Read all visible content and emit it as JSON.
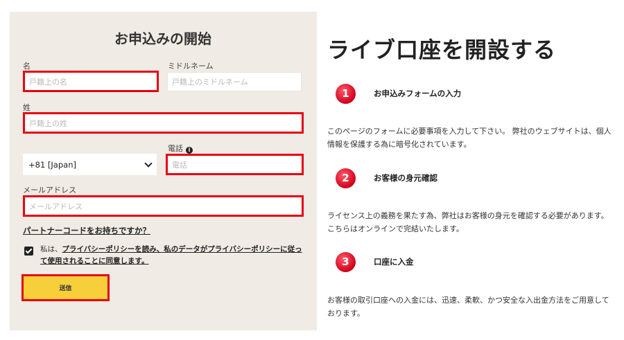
{
  "form": {
    "title": "お申込みの開始",
    "first_name": {
      "label": "名",
      "placeholder": "戸籍上の名"
    },
    "middle_name": {
      "label": "ミドルネーム",
      "placeholder": "戸籍上のミドルネーム"
    },
    "last_name": {
      "label": "姓",
      "placeholder": "戸籍上の姓"
    },
    "country_code": {
      "selected": "+81 [Japan]"
    },
    "phone": {
      "label": "電話",
      "placeholder": "電話"
    },
    "email": {
      "label": "メールアドレス",
      "placeholder": "メールアドレス"
    },
    "partner_link": "パートナーコードをお持ちですか？",
    "consent": {
      "prefix": "私は、",
      "link": "プライバシーポリシーを読み、私のデータがプライバシーポリシーに従って使用されることに同意します。"
    },
    "submit_label": "送信"
  },
  "info": {
    "title": "ライブ口座を開設する",
    "steps": [
      {
        "number": "1",
        "title": "お申込みフォームの入力",
        "desc_line1": "このページのフォームに必要事項を入力して下さい。 弊社のウェブサイトは、個人",
        "desc_line2": "情報を保護する為に暗号化されています。"
      },
      {
        "number": "2",
        "title": "お客様の身元確認",
        "desc_line1": "ライセンス上の義務を果たす為、弊社はお客様の身元を確認する必要があります。",
        "desc_line2": "こちらはオンラインで完結いたします。"
      },
      {
        "number": "3",
        "title": "口座に入金",
        "desc_line1": "お客様の取引口座への入金には、迅速、柔軟、かつ安全な入出金方法をご用意して",
        "desc_line2": "おります。"
      }
    ]
  },
  "colors": {
    "panel_bg": "#f0ebe4",
    "highlight_border": "#e60012",
    "submit_bg": "#f6cf3a",
    "step_circle": "#e60012"
  }
}
